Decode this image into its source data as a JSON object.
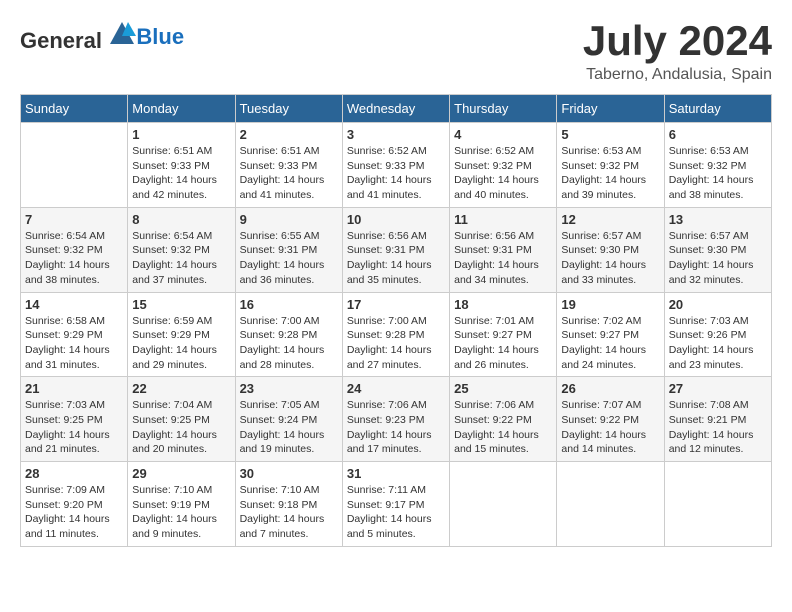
{
  "header": {
    "logo_general": "General",
    "logo_blue": "Blue",
    "month_title": "July 2024",
    "location": "Taberno, Andalusia, Spain"
  },
  "days_of_week": [
    "Sunday",
    "Monday",
    "Tuesday",
    "Wednesday",
    "Thursday",
    "Friday",
    "Saturday"
  ],
  "weeks": [
    [
      {
        "day": "",
        "info": ""
      },
      {
        "day": "1",
        "info": "Sunrise: 6:51 AM\nSunset: 9:33 PM\nDaylight: 14 hours\nand 42 minutes."
      },
      {
        "day": "2",
        "info": "Sunrise: 6:51 AM\nSunset: 9:33 PM\nDaylight: 14 hours\nand 41 minutes."
      },
      {
        "day": "3",
        "info": "Sunrise: 6:52 AM\nSunset: 9:33 PM\nDaylight: 14 hours\nand 41 minutes."
      },
      {
        "day": "4",
        "info": "Sunrise: 6:52 AM\nSunset: 9:32 PM\nDaylight: 14 hours\nand 40 minutes."
      },
      {
        "day": "5",
        "info": "Sunrise: 6:53 AM\nSunset: 9:32 PM\nDaylight: 14 hours\nand 39 minutes."
      },
      {
        "day": "6",
        "info": "Sunrise: 6:53 AM\nSunset: 9:32 PM\nDaylight: 14 hours\nand 38 minutes."
      }
    ],
    [
      {
        "day": "7",
        "info": "Sunrise: 6:54 AM\nSunset: 9:32 PM\nDaylight: 14 hours\nand 38 minutes."
      },
      {
        "day": "8",
        "info": "Sunrise: 6:54 AM\nSunset: 9:32 PM\nDaylight: 14 hours\nand 37 minutes."
      },
      {
        "day": "9",
        "info": "Sunrise: 6:55 AM\nSunset: 9:31 PM\nDaylight: 14 hours\nand 36 minutes."
      },
      {
        "day": "10",
        "info": "Sunrise: 6:56 AM\nSunset: 9:31 PM\nDaylight: 14 hours\nand 35 minutes."
      },
      {
        "day": "11",
        "info": "Sunrise: 6:56 AM\nSunset: 9:31 PM\nDaylight: 14 hours\nand 34 minutes."
      },
      {
        "day": "12",
        "info": "Sunrise: 6:57 AM\nSunset: 9:30 PM\nDaylight: 14 hours\nand 33 minutes."
      },
      {
        "day": "13",
        "info": "Sunrise: 6:57 AM\nSunset: 9:30 PM\nDaylight: 14 hours\nand 32 minutes."
      }
    ],
    [
      {
        "day": "14",
        "info": "Sunrise: 6:58 AM\nSunset: 9:29 PM\nDaylight: 14 hours\nand 31 minutes."
      },
      {
        "day": "15",
        "info": "Sunrise: 6:59 AM\nSunset: 9:29 PM\nDaylight: 14 hours\nand 29 minutes."
      },
      {
        "day": "16",
        "info": "Sunrise: 7:00 AM\nSunset: 9:28 PM\nDaylight: 14 hours\nand 28 minutes."
      },
      {
        "day": "17",
        "info": "Sunrise: 7:00 AM\nSunset: 9:28 PM\nDaylight: 14 hours\nand 27 minutes."
      },
      {
        "day": "18",
        "info": "Sunrise: 7:01 AM\nSunset: 9:27 PM\nDaylight: 14 hours\nand 26 minutes."
      },
      {
        "day": "19",
        "info": "Sunrise: 7:02 AM\nSunset: 9:27 PM\nDaylight: 14 hours\nand 24 minutes."
      },
      {
        "day": "20",
        "info": "Sunrise: 7:03 AM\nSunset: 9:26 PM\nDaylight: 14 hours\nand 23 minutes."
      }
    ],
    [
      {
        "day": "21",
        "info": "Sunrise: 7:03 AM\nSunset: 9:25 PM\nDaylight: 14 hours\nand 21 minutes."
      },
      {
        "day": "22",
        "info": "Sunrise: 7:04 AM\nSunset: 9:25 PM\nDaylight: 14 hours\nand 20 minutes."
      },
      {
        "day": "23",
        "info": "Sunrise: 7:05 AM\nSunset: 9:24 PM\nDaylight: 14 hours\nand 19 minutes."
      },
      {
        "day": "24",
        "info": "Sunrise: 7:06 AM\nSunset: 9:23 PM\nDaylight: 14 hours\nand 17 minutes."
      },
      {
        "day": "25",
        "info": "Sunrise: 7:06 AM\nSunset: 9:22 PM\nDaylight: 14 hours\nand 15 minutes."
      },
      {
        "day": "26",
        "info": "Sunrise: 7:07 AM\nSunset: 9:22 PM\nDaylight: 14 hours\nand 14 minutes."
      },
      {
        "day": "27",
        "info": "Sunrise: 7:08 AM\nSunset: 9:21 PM\nDaylight: 14 hours\nand 12 minutes."
      }
    ],
    [
      {
        "day": "28",
        "info": "Sunrise: 7:09 AM\nSunset: 9:20 PM\nDaylight: 14 hours\nand 11 minutes."
      },
      {
        "day": "29",
        "info": "Sunrise: 7:10 AM\nSunset: 9:19 PM\nDaylight: 14 hours\nand 9 minutes."
      },
      {
        "day": "30",
        "info": "Sunrise: 7:10 AM\nSunset: 9:18 PM\nDaylight: 14 hours\nand 7 minutes."
      },
      {
        "day": "31",
        "info": "Sunrise: 7:11 AM\nSunset: 9:17 PM\nDaylight: 14 hours\nand 5 minutes."
      },
      {
        "day": "",
        "info": ""
      },
      {
        "day": "",
        "info": ""
      },
      {
        "day": "",
        "info": ""
      }
    ]
  ]
}
